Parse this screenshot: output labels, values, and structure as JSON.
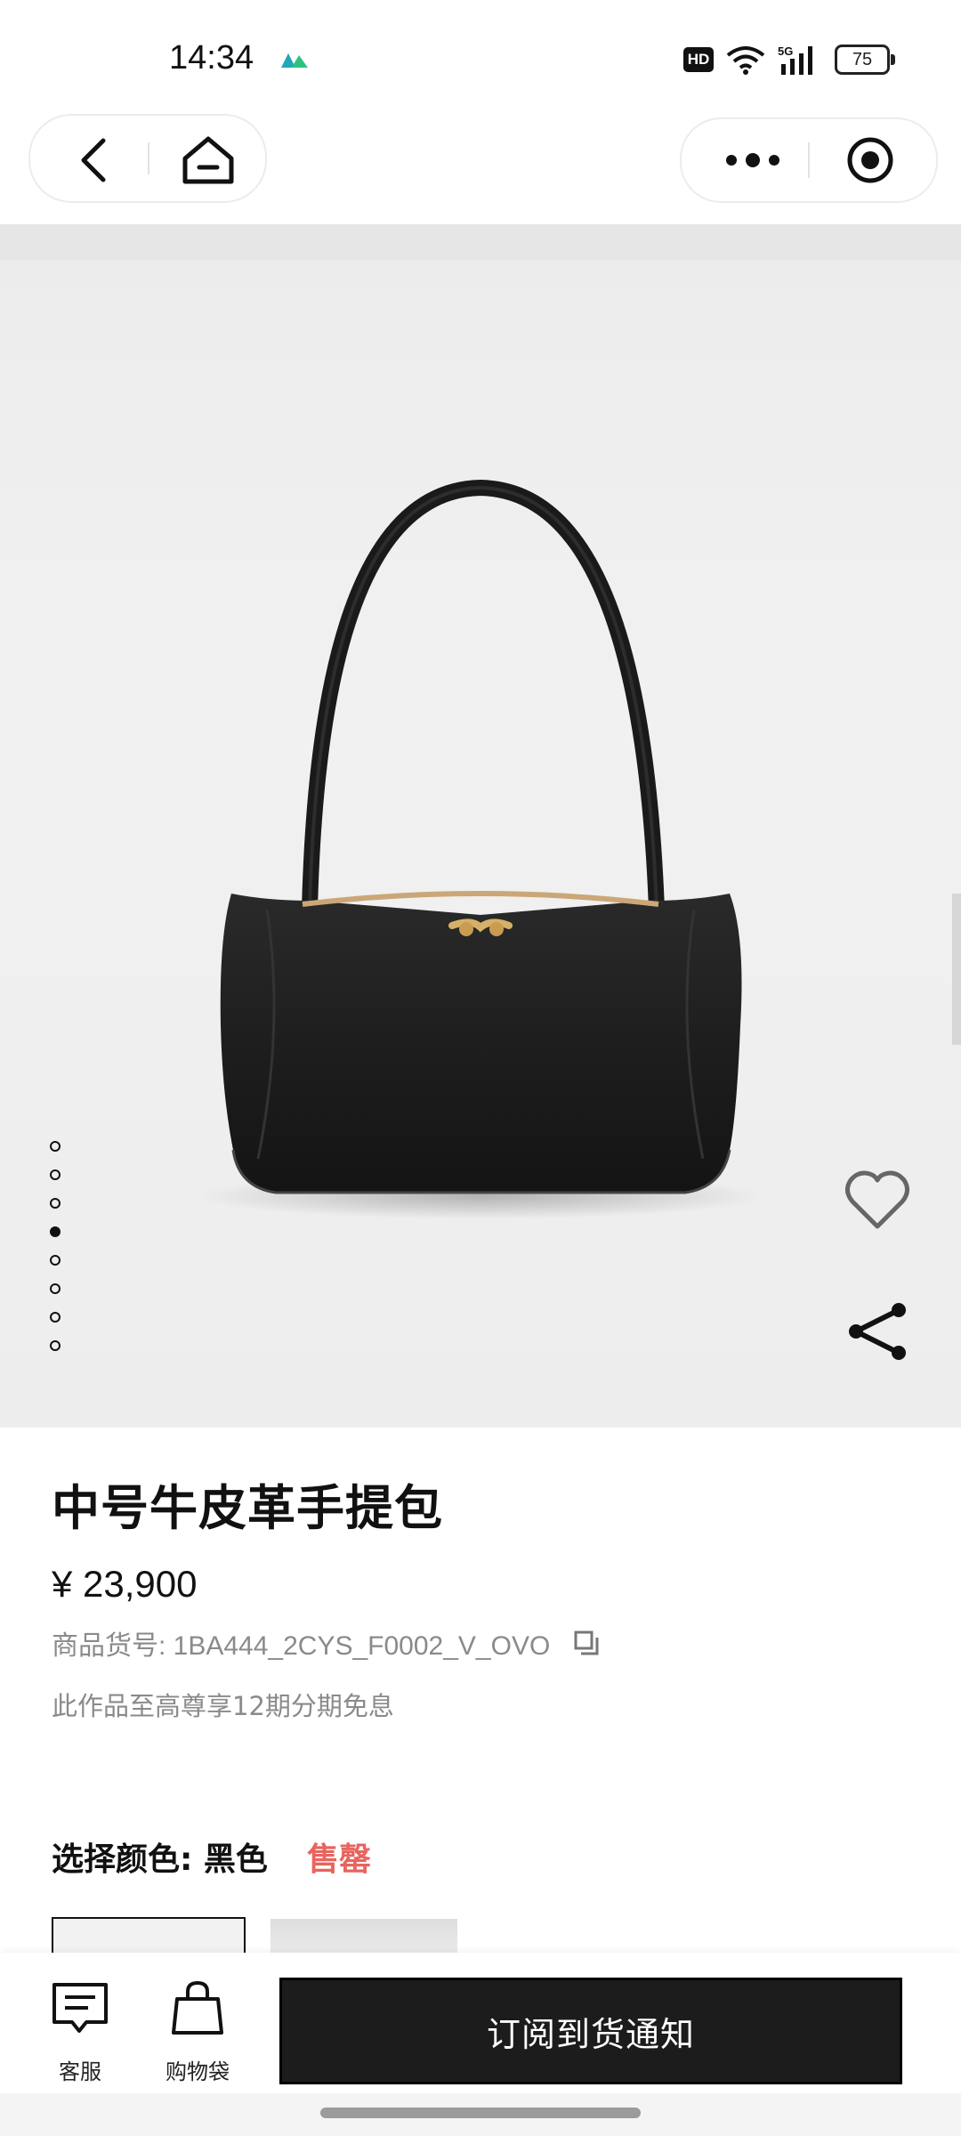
{
  "status_bar": {
    "time": "14:34",
    "hd_badge": "HD",
    "network": "5G",
    "battery": "75"
  },
  "nav": {
    "back_icon": "chevron-left-icon",
    "home_icon": "home-icon",
    "more_icon": "more-dots-icon",
    "target_icon": "target-icon"
  },
  "product": {
    "title": "中号牛皮革手提包",
    "price": "¥ 23,900",
    "sku_label": "商品货号: 1BA444_2CYS_F0002_V_OVO",
    "promo": "此作品至高尊享12期分期免息",
    "image_count": 8,
    "active_image": 4
  },
  "color": {
    "label": "选择颜色: 黑色",
    "status": "售罄"
  },
  "bottom_bar": {
    "service_label": "客服",
    "bag_label": "购物袋",
    "notify_label": "订阅到货通知"
  }
}
